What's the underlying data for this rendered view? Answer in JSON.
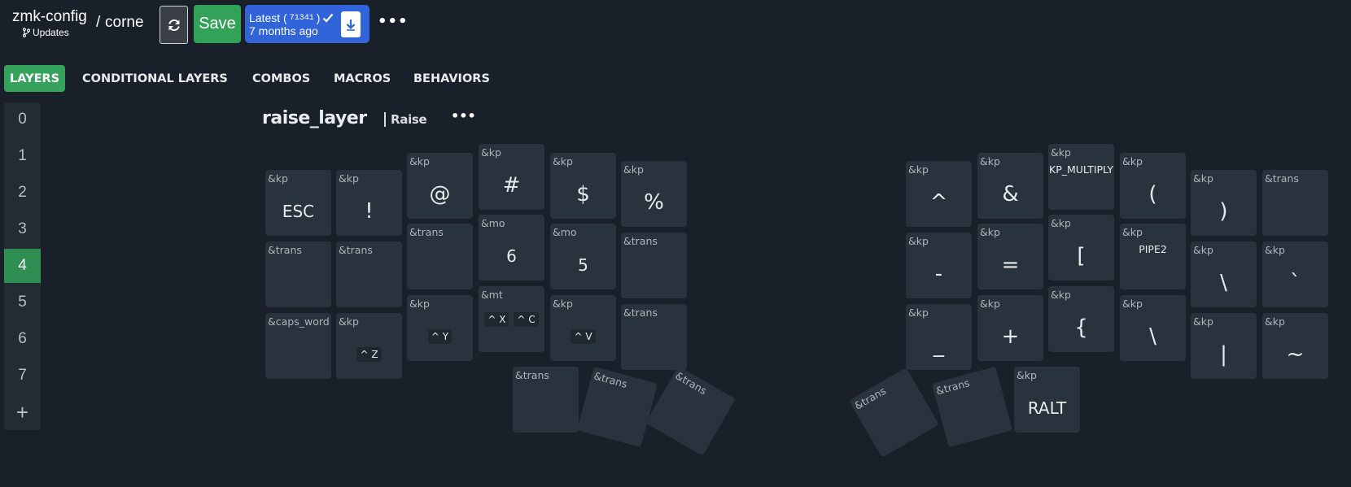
{
  "header": {
    "repo_name": "zmk-config",
    "repo_sub": "Updates",
    "separator": "/",
    "keyboard_name": "corne",
    "save_label": "Save",
    "latest_label": "Latest (",
    "latest_hash": "71341",
    "latest_close": ")",
    "latest_time": "7 months ago",
    "more": "•••"
  },
  "tabs": [
    {
      "label": "LAYERS"
    },
    {
      "label": "CONDITIONAL LAYERS"
    },
    {
      "label": "COMBOS"
    },
    {
      "label": "MACROS"
    },
    {
      "label": "BEHAVIORS"
    }
  ],
  "layers": [
    "0",
    "1",
    "2",
    "3",
    "4",
    "5",
    "6",
    "7"
  ],
  "active_layer": "4",
  "layer_add": "+",
  "layer": {
    "name": "raise_layer",
    "label": "Raise",
    "more": "•••"
  },
  "keys": [
    {
      "behavior": "&kp",
      "param": "ESC",
      "style": "word"
    },
    {
      "behavior": "&kp",
      "param": "!"
    },
    {
      "behavior": "&kp",
      "param": "@"
    },
    {
      "behavior": "&kp",
      "param": "#"
    },
    {
      "behavior": "&kp",
      "param": "$"
    },
    {
      "behavior": "&kp",
      "param": "%"
    },
    {
      "behavior": "&kp",
      "param": "^"
    },
    {
      "behavior": "&kp",
      "param": "&"
    },
    {
      "behavior": "&kp",
      "param": "KP_MULTIPLY",
      "style": "small"
    },
    {
      "behavior": "&kp",
      "param": "("
    },
    {
      "behavior": "&kp",
      "param": ")"
    },
    {
      "behavior": "&trans",
      "param": ""
    },
    {
      "behavior": "&trans",
      "param": ""
    },
    {
      "behavior": "&trans",
      "param": ""
    },
    {
      "behavior": "&trans",
      "param": ""
    },
    {
      "behavior": "&mo",
      "param": "6",
      "style": "word"
    },
    {
      "behavior": "&mo",
      "param": "5",
      "style": "word"
    },
    {
      "behavior": "&trans",
      "param": ""
    },
    {
      "behavior": "&kp",
      "param": "-"
    },
    {
      "behavior": "&kp",
      "param": "="
    },
    {
      "behavior": "&kp",
      "param": "["
    },
    {
      "behavior": "&kp",
      "param": "PIPE2",
      "style": "small"
    },
    {
      "behavior": "&kp",
      "param": "\\"
    },
    {
      "behavior": "&kp",
      "param": "`"
    },
    {
      "behavior": "&caps_word",
      "param": ""
    },
    {
      "behavior": "&kp",
      "param": "^ Z",
      "style": "chip"
    },
    {
      "behavior": "&kp",
      "param": "^ Y",
      "style": "chip"
    },
    {
      "behavior": "&mt",
      "param": [
        "^ X",
        "^ C"
      ],
      "style": "chips"
    },
    {
      "behavior": "&kp",
      "param": "^ V",
      "style": "chip"
    },
    {
      "behavior": "&trans",
      "param": ""
    },
    {
      "behavior": "&kp",
      "param": "_"
    },
    {
      "behavior": "&kp",
      "param": "+"
    },
    {
      "behavior": "&kp",
      "param": "{"
    },
    {
      "behavior": "&kp",
      "param": "\\"
    },
    {
      "behavior": "&kp",
      "param": "|"
    },
    {
      "behavior": "&kp",
      "param": "~"
    },
    {
      "behavior": "&trans",
      "param": ""
    },
    {
      "behavior": "&trans",
      "param": ""
    },
    {
      "behavior": "&trans",
      "param": ""
    },
    {
      "behavior": "&trans",
      "param": ""
    },
    {
      "behavior": "&trans",
      "param": ""
    },
    {
      "behavior": "&kp",
      "param": "RALT",
      "style": "word"
    }
  ]
}
